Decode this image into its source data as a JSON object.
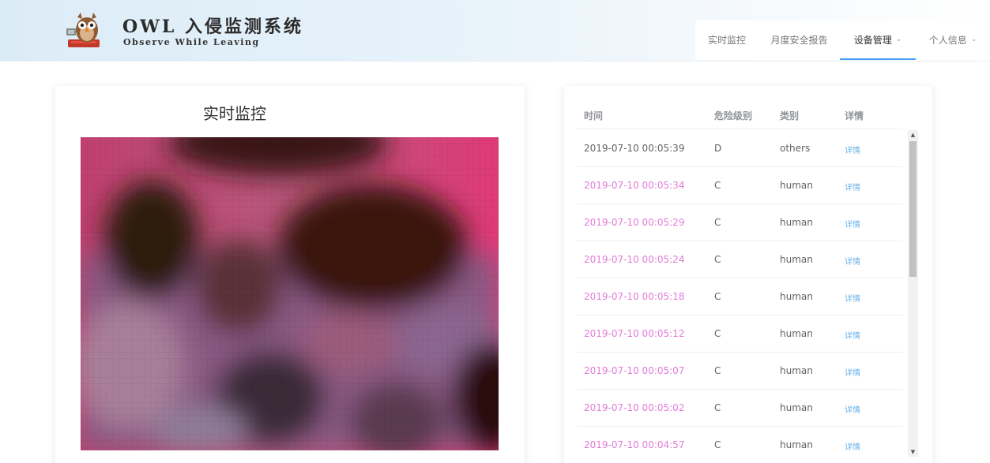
{
  "header": {
    "brand_title": "OWL 入侵监测系统",
    "brand_subtitle": "Observe While Leaving"
  },
  "nav": {
    "items": [
      {
        "label": "实时监控",
        "active": false,
        "has_dropdown": false
      },
      {
        "label": "月度安全报告",
        "active": false,
        "has_dropdown": false
      },
      {
        "label": "设备管理",
        "active": true,
        "has_dropdown": true
      },
      {
        "label": "个人信息",
        "active": false,
        "has_dropdown": true
      }
    ],
    "dropdown_icon": "chevron-down-icon"
  },
  "monitor": {
    "title": "实时监控"
  },
  "events_table": {
    "headers": {
      "time": "时间",
      "level": "危险级别",
      "type": "类别",
      "detail": "详情"
    },
    "rows": [
      {
        "time": "2019-07-10 00:05:39",
        "level": "D",
        "type": "others",
        "detail": "详情"
      },
      {
        "time": "2019-07-10 00:05:34",
        "level": "C",
        "type": "human",
        "detail": "详情"
      },
      {
        "time": "2019-07-10 00:05:29",
        "level": "C",
        "type": "human",
        "detail": "详情"
      },
      {
        "time": "2019-07-10 00:05:24",
        "level": "C",
        "type": "human",
        "detail": "详情"
      },
      {
        "time": "2019-07-10 00:05:18",
        "level": "C",
        "type": "human",
        "detail": "详情"
      },
      {
        "time": "2019-07-10 00:05:12",
        "level": "C",
        "type": "human",
        "detail": "详情"
      },
      {
        "time": "2019-07-10 00:05:07",
        "level": "C",
        "type": "human",
        "detail": "详情"
      },
      {
        "time": "2019-07-10 00:05:02",
        "level": "C",
        "type": "human",
        "detail": "详情"
      },
      {
        "time": "2019-07-10 00:04:57",
        "level": "C",
        "type": "human",
        "detail": "详情"
      }
    ]
  },
  "colors": {
    "alert_time": "#e27bd8",
    "detail_link": "#67b1e8",
    "active_nav_underline": "#409eff",
    "header_bg": "#dcecf7"
  }
}
